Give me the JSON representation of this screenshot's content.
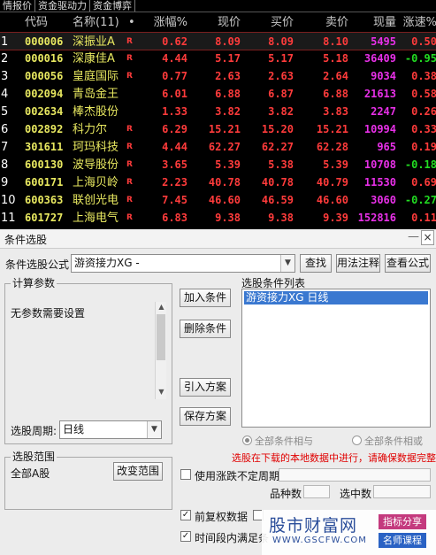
{
  "tabs": [
    "情报价",
    "资金驱动力",
    "资金博弈"
  ],
  "table": {
    "headers": {
      "code": "代码",
      "name": "名称(11)",
      "dot": "•",
      "pct": "涨幅%",
      "cur": "现价",
      "buy": "买价",
      "sell": "卖价",
      "vol": "现量",
      "spd": "涨速%"
    },
    "rows": [
      {
        "idx": "1",
        "code": "000006",
        "name": "深振业A",
        "flag": "R",
        "pct": "0.62",
        "cur": "8.09",
        "buy": "8.09",
        "sell": "8.10",
        "vol": "5495",
        "spd": "0.50",
        "spd_dir": "up"
      },
      {
        "idx": "2",
        "code": "000016",
        "name": "深康佳A",
        "flag": "R",
        "pct": "4.44",
        "cur": "5.17",
        "buy": "5.17",
        "sell": "5.18",
        "vol": "36409",
        "spd": "-0.95",
        "spd_dir": "dn"
      },
      {
        "idx": "3",
        "code": "000056",
        "name": "皇庭国际",
        "flag": "R",
        "pct": "0.77",
        "cur": "2.63",
        "buy": "2.63",
        "sell": "2.64",
        "vol": "9034",
        "spd": "0.38",
        "spd_dir": "up"
      },
      {
        "idx": "4",
        "code": "002094",
        "name": "青岛金王",
        "flag": "",
        "pct": "6.01",
        "cur": "6.88",
        "buy": "6.87",
        "sell": "6.88",
        "vol": "21613",
        "spd": "0.58",
        "spd_dir": "up"
      },
      {
        "idx": "5",
        "code": "002634",
        "name": "棒杰股份",
        "flag": "",
        "pct": "1.33",
        "cur": "3.82",
        "buy": "3.82",
        "sell": "3.83",
        "vol": "2247",
        "spd": "0.26",
        "spd_dir": "up"
      },
      {
        "idx": "6",
        "code": "002892",
        "name": "科力尔",
        "flag": "R",
        "pct": "6.29",
        "cur": "15.21",
        "buy": "15.20",
        "sell": "15.21",
        "vol": "10994",
        "spd": "0.33",
        "spd_dir": "up"
      },
      {
        "idx": "7",
        "code": "301611",
        "name": "珂玛科技",
        "flag": "R",
        "pct": "4.44",
        "cur": "62.27",
        "buy": "62.27",
        "sell": "62.28",
        "vol": "965",
        "spd": "0.19",
        "spd_dir": "up"
      },
      {
        "idx": "8",
        "code": "600130",
        "name": "波导股份",
        "flag": "R",
        "pct": "3.65",
        "cur": "5.39",
        "buy": "5.38",
        "sell": "5.39",
        "vol": "10708",
        "spd": "-0.18",
        "spd_dir": "dn"
      },
      {
        "idx": "9",
        "code": "600171",
        "name": "上海贝岭",
        "flag": "R",
        "pct": "2.23",
        "cur": "40.78",
        "buy": "40.78",
        "sell": "40.79",
        "vol": "11530",
        "spd": "0.69",
        "spd_dir": "up"
      },
      {
        "idx": "10",
        "code": "600363",
        "name": "联创光电",
        "flag": "R",
        "pct": "7.45",
        "cur": "46.60",
        "buy": "46.59",
        "sell": "46.60",
        "vol": "3060",
        "spd": "-0.27",
        "spd_dir": "dn"
      },
      {
        "idx": "11",
        "code": "601727",
        "name": "上海电气",
        "flag": "R",
        "pct": "6.83",
        "cur": "9.38",
        "buy": "9.38",
        "sell": "9.39",
        "vol": "152816",
        "spd": "0.11",
        "spd_dir": "up"
      }
    ],
    "selected_row": 0
  },
  "dialog": {
    "title": "条件选股",
    "min_glyph": "—",
    "close_glyph": "×",
    "formula_label": "条件选股公式",
    "formula_value": "游资接力XG  -",
    "btn_find": "查找",
    "btn_usage": "用法注释",
    "btn_view": "查看公式",
    "params_group": "计算参数",
    "params_text": "无参数需要设置",
    "btn_add": "加入条件",
    "btn_del": "删除条件",
    "btn_import": "引入方案",
    "btn_save": "保存方案",
    "cond_list_label": "选股条件列表",
    "cond_item": "游资接力XG  日线",
    "period_label": "选股周期:",
    "period_value": "日线",
    "radio_and": "全部条件相与",
    "radio_or": "全部条件相或",
    "warning": "选股在下载的本地数据中进行，请确保数据完整",
    "range_group": "选股范围",
    "range_value": "全部A股",
    "btn_range": "改变范围",
    "chk_uncertain": "使用涨跌不定周期",
    "count_label": "品种数",
    "selected_label": "选中数",
    "chk_adjust": "前复权数据",
    "chk_period": "时间段内满足条"
  },
  "watermark": {
    "brand": "股市财富网",
    "url": "WWW.GSCFW.COM",
    "tag1": "指标分享",
    "tag2": "名师课程"
  }
}
